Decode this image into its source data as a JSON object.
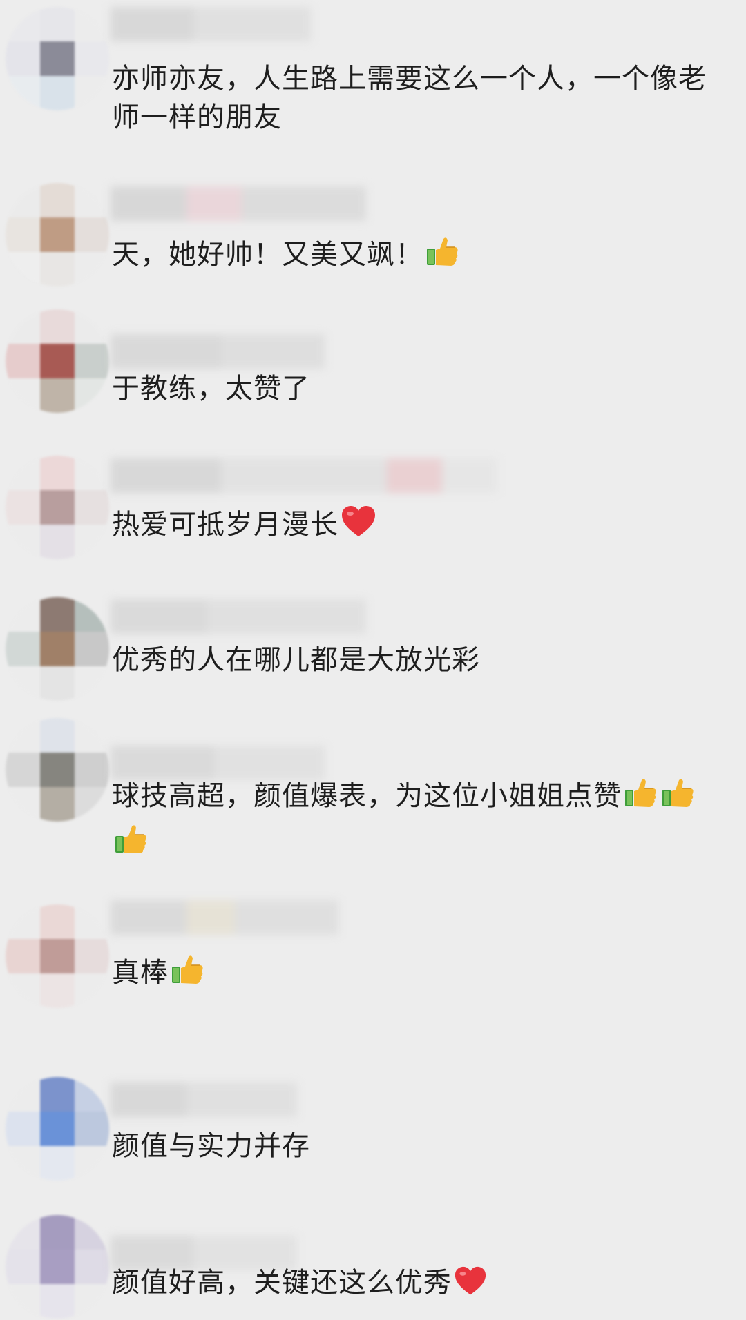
{
  "comments": [
    {
      "text": "亦师亦友，人生路上需要这么一个人，一个像老师一样的朋友",
      "emoji": []
    },
    {
      "text": "天，她好帅！又美又飒！",
      "emoji": [
        "thumbs-up"
      ]
    },
    {
      "text": "于教练，太赞了",
      "emoji": []
    },
    {
      "text": "热爱可抵岁月漫长",
      "emoji": [
        "red-heart"
      ]
    },
    {
      "text": "优秀的人在哪儿都是大放光彩",
      "emoji": []
    },
    {
      "text": "球技高超，颜值爆表，为这位小姐姐点赞",
      "emoji": [
        "thumbs-up",
        "thumbs-up",
        "thumbs-up"
      ]
    },
    {
      "text": "真棒",
      "emoji": [
        "thumbs-up"
      ]
    },
    {
      "text": "颜值与实力并存",
      "emoji": []
    },
    {
      "text": "颜值好高，关键还这么优秀",
      "emoji": [
        "red-heart"
      ]
    }
  ],
  "colors": {
    "background": "#ededed",
    "text": "#1e1e1e",
    "heart": "#e8333c",
    "thumb": "#f5b52e",
    "cuff": "#3f9e3a"
  }
}
